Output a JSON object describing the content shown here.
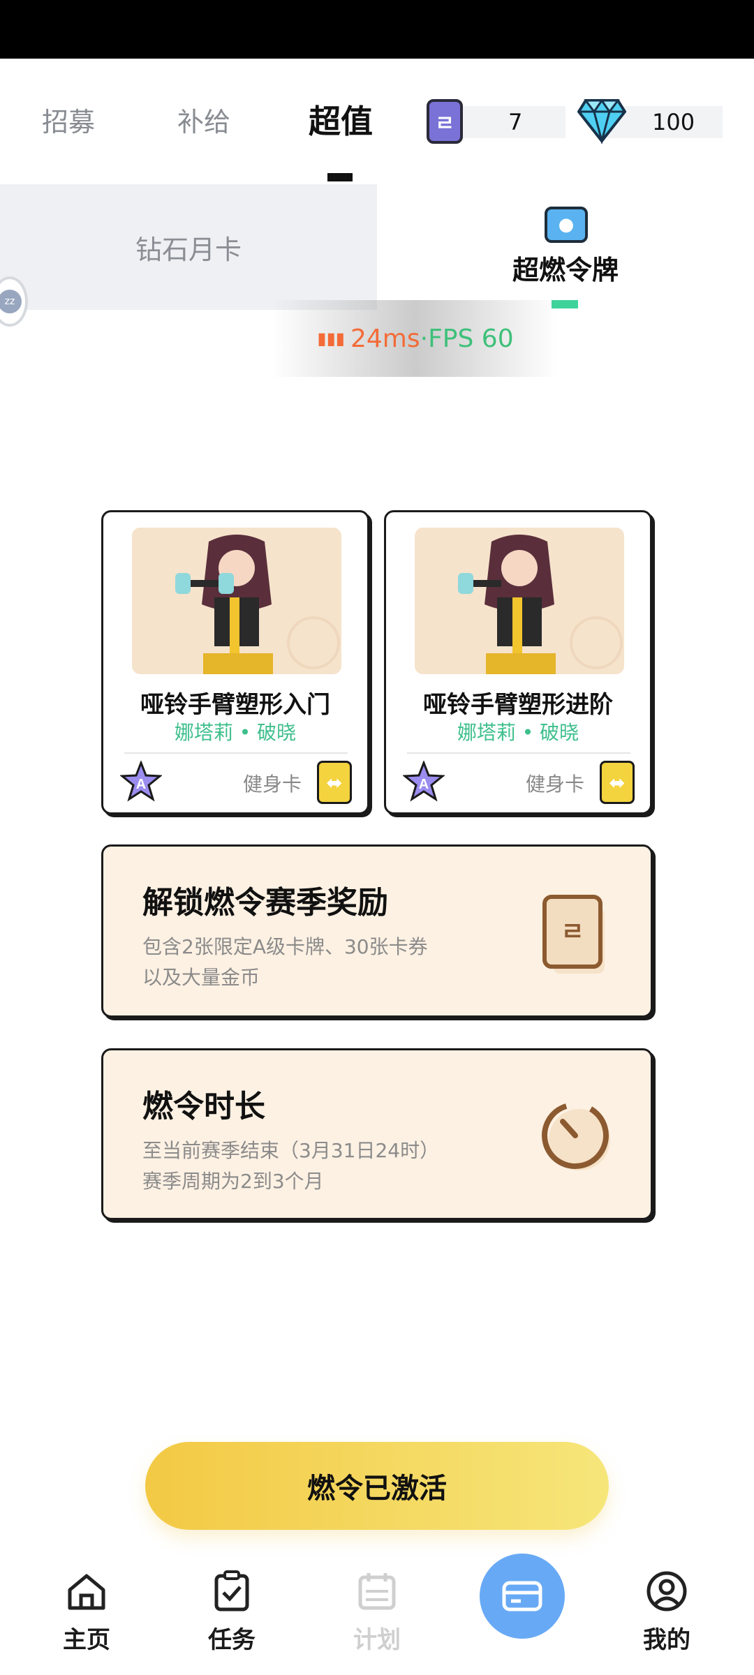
{
  "top_tabs": [
    {
      "label": "招募"
    },
    {
      "label": "补给"
    },
    {
      "label": "超值"
    }
  ],
  "currency": {
    "token_icon_text": "ㄹ",
    "token_value": "7",
    "diamond_value": "100"
  },
  "subtabs": {
    "left": "钻石月卡",
    "right": "超燃令牌",
    "right_icon_text": "●"
  },
  "floating_ball": "zz",
  "network": {
    "latency": "24ms",
    "separator": " · ",
    "fps": "FPS 60"
  },
  "cards": [
    {
      "title": "哑铃手臂塑形入门",
      "subtitle": "娜塔莉 • 破晓",
      "rank": "A",
      "type_label": "健身卡"
    },
    {
      "title": "哑铃手臂塑形进阶",
      "subtitle": "娜塔莉 • 破晓",
      "rank": "A",
      "type_label": "健身卡"
    }
  ],
  "panels": [
    {
      "title": "解锁燃令赛季奖励",
      "lines": [
        "包含2张限定A级卡牌、30张卡券",
        "以及大量金币"
      ],
      "icon": "token-card-icon",
      "icon_text": "ㄹ"
    },
    {
      "title": "燃令时长",
      "lines": [
        "至当前赛季结束（3月31日24时）",
        "赛季周期为2到3个月"
      ],
      "icon": "timer-icon"
    }
  ],
  "activate_button": "燃令已激活",
  "bottom_nav": [
    {
      "label": "主页",
      "icon": "home-icon"
    },
    {
      "label": "任务",
      "icon": "task-icon"
    },
    {
      "label": "计划",
      "icon": "calendar-icon"
    },
    {
      "label": "",
      "icon": "card-icon"
    },
    {
      "label": "我的",
      "icon": "profile-icon"
    }
  ],
  "colors": {
    "accent_green": "#3ebf8c",
    "panel_bg": "#fdf1e3",
    "button_yellow": "#f3c944",
    "center_nav_blue": "#67a9f5"
  }
}
